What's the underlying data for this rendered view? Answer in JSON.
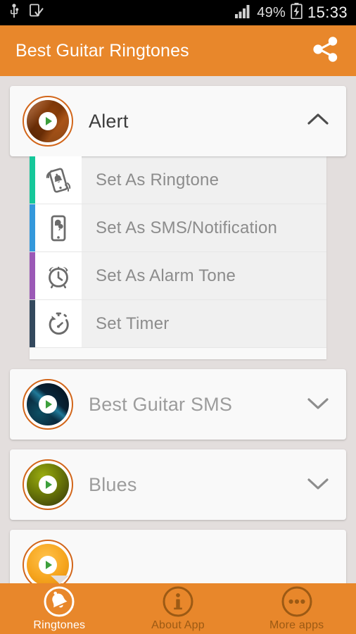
{
  "status_bar": {
    "left_icons": [
      "usb-icon",
      "device-check-icon"
    ],
    "signal_icon": "signal-bars-icon",
    "battery_text": "49%",
    "battery_icon": "battery-charging-icon",
    "clock": "15:33"
  },
  "app_bar": {
    "title": "Best Guitar Ringtones",
    "share_icon": "share-icon",
    "background": "#e8872b"
  },
  "ringtones": [
    {
      "title": "Alert",
      "expanded": true,
      "thumb_class": "t-alert",
      "play_icon": "play-icon",
      "chevron": "chevron-up-icon"
    },
    {
      "title": "Best Guitar SMS",
      "expanded": false,
      "thumb_class": "t-sms",
      "play_icon": "play-icon",
      "chevron": "chevron-down-icon"
    },
    {
      "title": "Blues",
      "expanded": false,
      "thumb_class": "t-blues",
      "play_icon": "play-icon",
      "chevron": "chevron-down-icon"
    },
    {
      "title": "",
      "expanded": false,
      "thumb_class": "t-orange",
      "play_icon": "play-icon",
      "chevron": "chevron-down-icon"
    }
  ],
  "actions": [
    {
      "label": "Set As Ringtone",
      "color": "#16c79a",
      "icon": "vibrating-phone-icon"
    },
    {
      "label": "Set As SMS/Notification",
      "color": "#3498db",
      "icon": "phone-message-icon"
    },
    {
      "label": "Set As Alarm Tone",
      "color": "#9b59b6",
      "icon": "alarm-clock-icon"
    },
    {
      "label": "Set Timer",
      "color": "#34495e",
      "icon": "stopwatch-icon"
    }
  ],
  "bottom_nav": [
    {
      "label": "Ringtones",
      "icon": "bell-icon",
      "active": true
    },
    {
      "label": "About App",
      "icon": "info-icon",
      "active": false
    },
    {
      "label": "More apps",
      "icon": "more-dots-icon",
      "active": false
    }
  ]
}
